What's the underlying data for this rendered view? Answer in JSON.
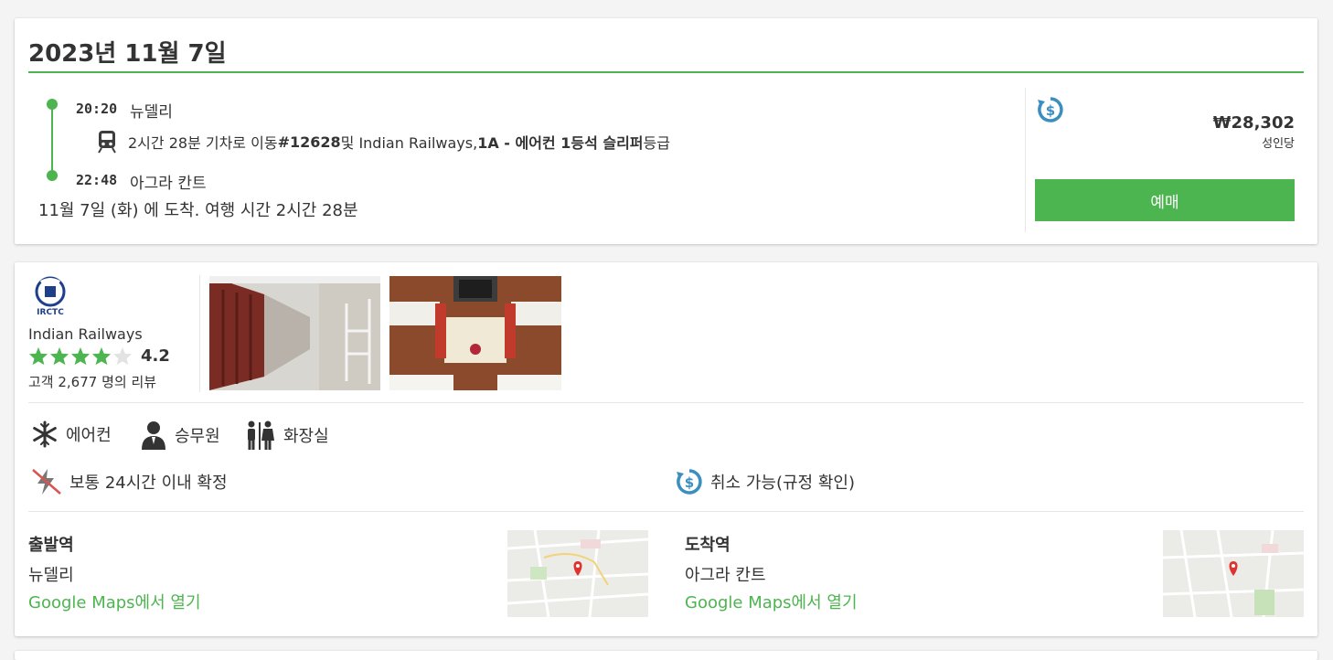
{
  "journey": {
    "date": "2023년 11월 7일",
    "departure_time": "20:20",
    "departure_station": "뉴델리",
    "train_prefix": "2시간 28분 기차로 이동 ",
    "train_number": "#12628",
    "train_mid": " 및 Indian Railways, ",
    "train_class": "1A - 에어컨 1등석 슬리퍼",
    "train_suffix": " 등급",
    "arrival_time": "22:48",
    "arrival_station": "아그라 칸트",
    "arrival_note": "11월 7일 (화) 에 도착. 여행 시간 2시간 28분"
  },
  "booking": {
    "price": "₩28,302",
    "price_unit": "성인당",
    "book_label": "예매",
    "refund_icon": "refund-icon"
  },
  "operator": {
    "logo_text": "IRCTC",
    "name": "Indian Railways",
    "rating_stars": 4,
    "rating": "4.2",
    "reviews": "고객 2,677 명의 리뷰"
  },
  "amenities": [
    {
      "label": "에어컨",
      "icon": "snowflake-icon"
    },
    {
      "label": "승무원",
      "icon": "person-icon"
    },
    {
      "label": "화장실",
      "icon": "restroom-icon"
    }
  ],
  "features": {
    "confirmation": "보통 24시간 이내 확정",
    "cancellation": "취소 가능(규정 확인)"
  },
  "stations": {
    "departure": {
      "heading": "출발역",
      "name": "뉴델리",
      "map_link": "Google Maps에서 열기"
    },
    "arrival": {
      "heading": "도착역",
      "name": "아그라 칸트",
      "map_link": "Google Maps에서 열기"
    }
  },
  "colors": {
    "accent": "#4cb54f",
    "refund": "#3a8fc0",
    "text": "#333333"
  }
}
